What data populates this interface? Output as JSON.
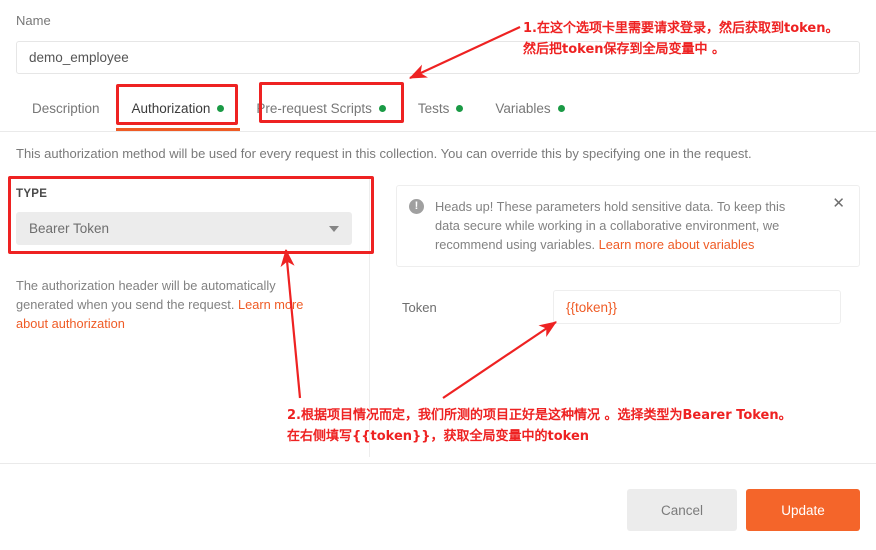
{
  "name_field": {
    "label": "Name",
    "value": "demo_employee",
    "placeholder": "Name"
  },
  "tabs": [
    {
      "label": "Description",
      "active": false,
      "dot": false
    },
    {
      "label": "Authorization",
      "active": true,
      "dot": true
    },
    {
      "label": "Pre-request Scripts",
      "active": false,
      "dot": true
    },
    {
      "label": "Tests",
      "active": false,
      "dot": true
    },
    {
      "label": "Variables",
      "active": false,
      "dot": true
    }
  ],
  "auth": {
    "description": "This authorization method will be used for every request in this collection. You can override this by specifying one in the request.",
    "type_label": "TYPE",
    "type_value": "Bearer Token",
    "help_text": "The authorization header will be automatically generated when you send the request. ",
    "help_link": "Learn more about authorization"
  },
  "notice": {
    "icon": "info-exclamation-icon",
    "text": "Heads up! These parameters hold sensitive data. To keep this data secure while working in a collaborative environment, we recommend using variables. ",
    "link": "Learn more about variables",
    "close_glyph": "✕"
  },
  "token": {
    "label": "Token",
    "value": "{{token}}",
    "placeholder": "Token"
  },
  "footer": {
    "cancel_label": "Cancel",
    "update_label": "Update"
  },
  "annotations": {
    "note1": "1.在这个选项卡里需要请求登录，然后获取到token。\n然后把token保存到全局变量中 。",
    "note2": "2.根据项目情况而定，我们所测的项目正好是这种情况 。选择类型为Bearer Token。\n在右侧填写{{token}}，获取全局变量中的token"
  },
  "colors": {
    "accent": "#ef5b25",
    "update_button": "#f4652a",
    "annotation_red": "#ee2222",
    "status_dot_green": "#1a9a45",
    "text_muted": "#828282"
  }
}
